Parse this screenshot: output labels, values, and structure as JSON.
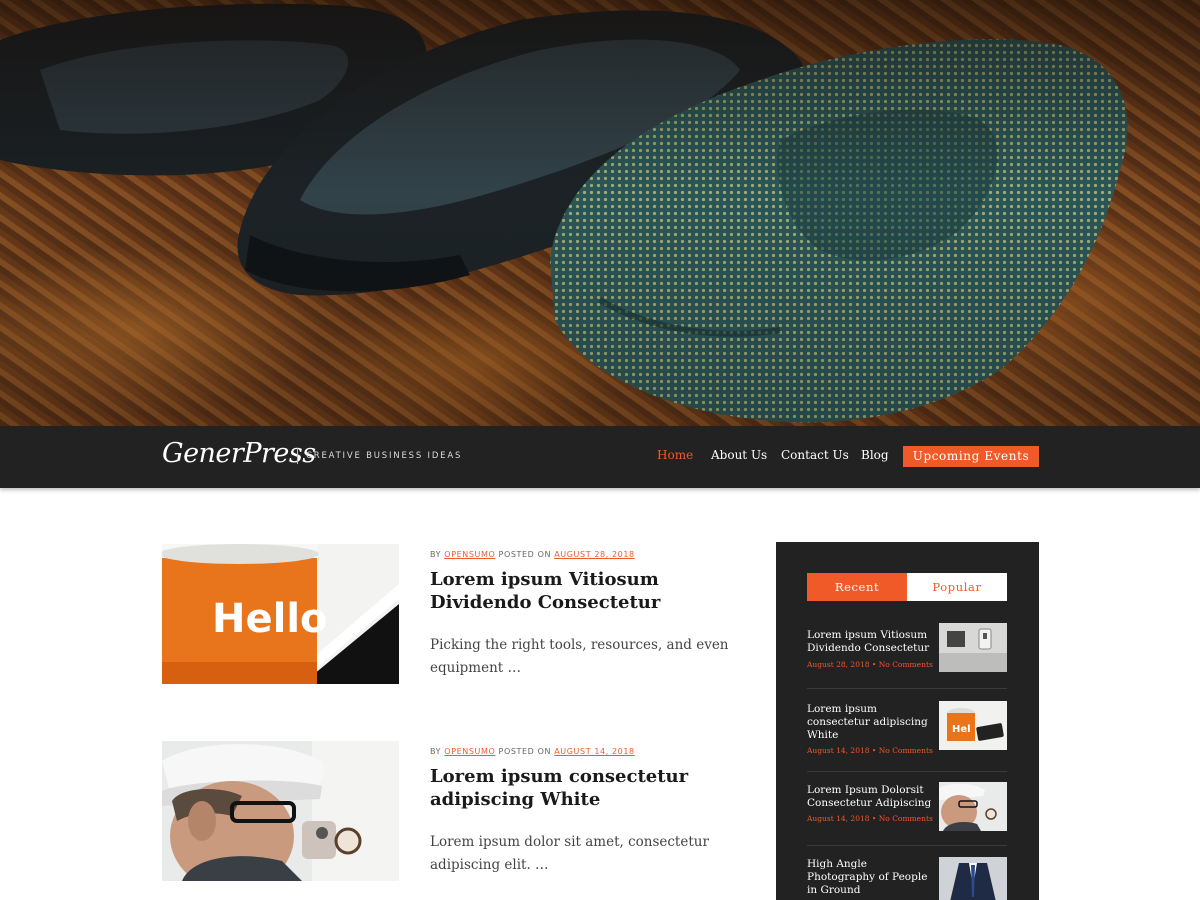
{
  "hero": {
    "image": "shoes-and-tie-photo"
  },
  "header": {
    "logo": "GenerPress",
    "tagline": "Creative Business Ideas"
  },
  "nav": {
    "items": [
      {
        "label": "Home",
        "active": true
      },
      {
        "label": "About Us",
        "active": false
      },
      {
        "label": "Contact Us",
        "active": false
      },
      {
        "label": "Blog",
        "active": false
      }
    ],
    "cta": "Upcoming Events"
  },
  "posts": [
    {
      "by": "BY",
      "author": "OPENSUMO",
      "posted_on": "POSTED ON",
      "date": "AUGUST 28, 2018",
      "title": "Lorem ipsum Vitiosum Dividendo Consectetur",
      "excerpt": "Picking the right tools, resources, and even equipment …",
      "thumb_text": "Hello"
    },
    {
      "by": "BY",
      "author": "OPENSUMO",
      "posted_on": "POSTED ON",
      "date": "AUGUST 14, 2018",
      "title": "Lorem ipsum consectetur adipiscing White",
      "excerpt": "Lorem ipsum dolor sit amet, consectetur adipiscing elit. …"
    }
  ],
  "sidebar": {
    "tabs": {
      "recent": "Recent",
      "popular": "Popular"
    },
    "items": [
      {
        "title": "Lorem ipsum Vitiosum Dividendo Consectetur",
        "date": "August 28, 2018",
        "comments": "No Comments"
      },
      {
        "title": "Lorem ipsum consectetur adipiscing White",
        "date": "August 14, 2018",
        "comments": "No Comments"
      },
      {
        "title": "Lorem Ipsum Dolorsit Consectetur Adipiscing",
        "date": "August 14, 2018",
        "comments": "No Comments"
      },
      {
        "title": "High Angle Photography of People in Ground"
      }
    ]
  },
  "colors": {
    "accent": "#f05a28",
    "header_bg": "#222222",
    "sidebar_bg": "#222222"
  }
}
